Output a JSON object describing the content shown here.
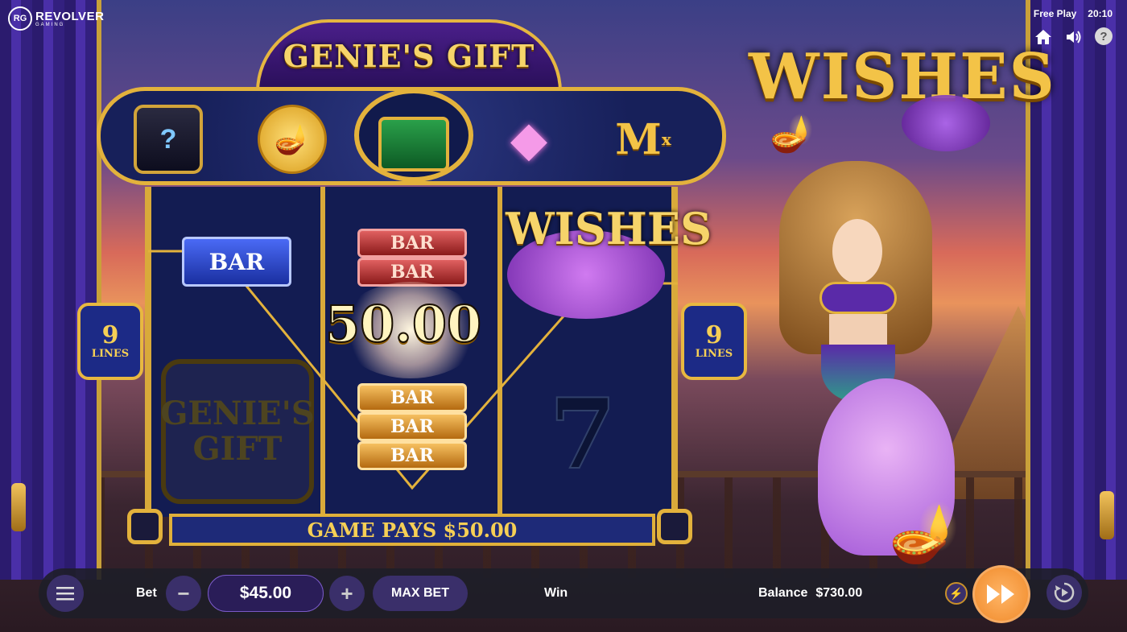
{
  "brand": {
    "badge": "RG",
    "name": "REVOLVER",
    "sub": "GAMING"
  },
  "status": {
    "mode": "Free Play",
    "time": "20:10"
  },
  "icons": {
    "home": "home-icon",
    "sound": "speaker-icon",
    "help": "?"
  },
  "game": {
    "title": "GENIE'S GIFT",
    "feature_title": "WISHES",
    "lines_left": {
      "number": "9",
      "label": "LINES"
    },
    "lines_right": {
      "number": "9",
      "label": "LINES"
    },
    "win_amount": "50.00",
    "pays_text": "GAME PAYS $50.00",
    "top_symbols": [
      "mystery",
      "lamp-coin",
      "treasure-chest",
      "pink-diamond",
      "multiplier"
    ],
    "reel_symbols": {
      "reel1": [
        "BAR",
        "GENIE'S GIFT"
      ],
      "reel2": [
        "BAR",
        "BAR",
        "BAR",
        "BAR",
        "BAR"
      ],
      "reel3": [
        "WISHES",
        "7"
      ]
    },
    "faded_logo": "GENIE'S\nGIFT",
    "seven": "7",
    "mult": "M",
    "mult_sup": "x"
  },
  "controls": {
    "bet_label": "Bet",
    "bet_value": "$45.00",
    "minus": "−",
    "plus": "+",
    "max_bet": "MAX BET",
    "win_label": "Win",
    "balance_label": "Balance",
    "balance_value": "$730.00"
  }
}
